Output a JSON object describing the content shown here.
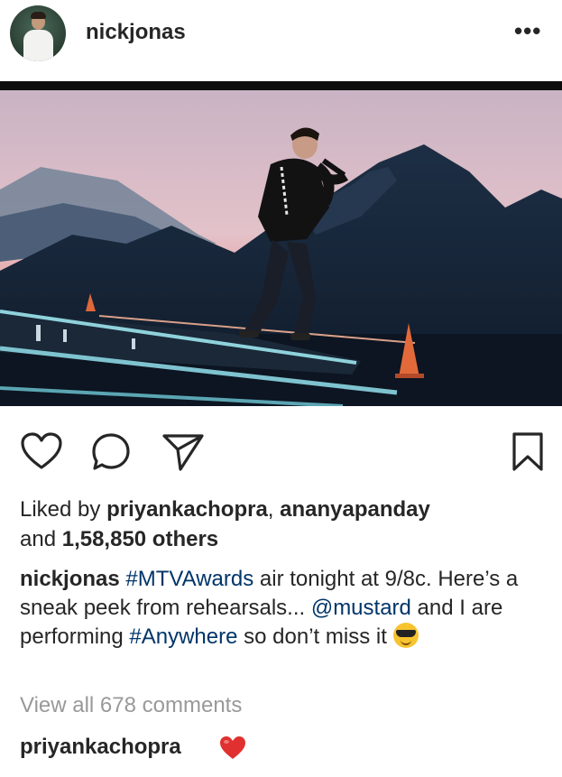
{
  "post": {
    "username": "nickjonas",
    "more_glyph": "•••",
    "avatar_icon": "profile-avatar"
  },
  "actions": {
    "icons": [
      "heart-icon",
      "comment-icon",
      "share-icon",
      "bookmark-icon"
    ]
  },
  "likes": {
    "prefix": "Liked by",
    "user1": "priyankachopra",
    "separator": ",",
    "user2": "ananyapanday",
    "and": "and",
    "count_text": "1,58,850 others"
  },
  "caption": {
    "username": "nickjonas",
    "hashtag1": "#MTVAwards",
    "text1": " air tonight at 9/8c. Here’s a sneak peek from rehearsals...",
    "mention": "@mustard",
    "text2": " and I are performing ",
    "hashtag2": "#Anywhere",
    "text3": " so don’t miss it",
    "emoji": "smiling-face-with-sunglasses"
  },
  "comments": {
    "view_all": "View all 678 comments",
    "items": [
      {
        "username": "priyankachopra",
        "emoji": "red-heart"
      }
    ]
  },
  "colors": {
    "text": "#262626",
    "link": "#003569",
    "muted": "#999999",
    "heart": "#ed4956"
  }
}
